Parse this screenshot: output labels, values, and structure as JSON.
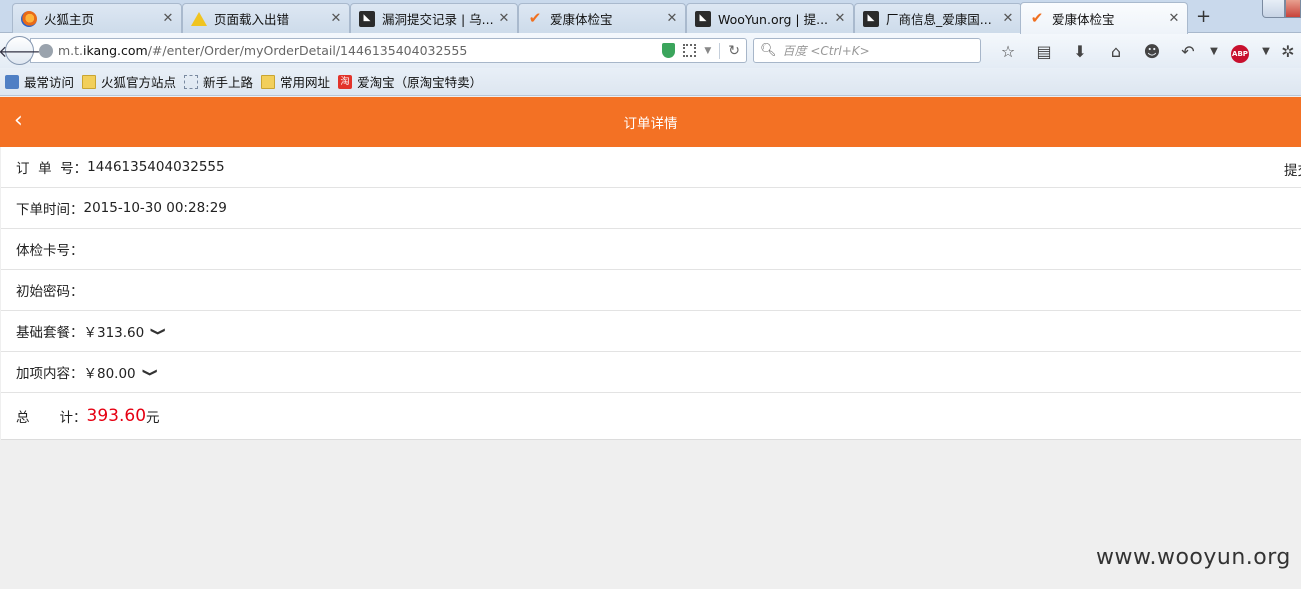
{
  "browser": {
    "tabs": [
      {
        "label": "火狐主页",
        "icon": "firefox-icon"
      },
      {
        "label": "页面载入出错",
        "icon": "warning-icon"
      },
      {
        "label": "漏洞提交记录 | 乌...",
        "icon": "wooyun-icon"
      },
      {
        "label": "爱康体检宝",
        "icon": "ikang-check-icon"
      },
      {
        "label": "WooYun.org | 提...",
        "icon": "wooyun-icon"
      },
      {
        "label": "厂商信息_爱康国...",
        "icon": "wooyun-icon"
      },
      {
        "label": "爱康体检宝",
        "icon": "ikang-check-icon",
        "active": true
      }
    ],
    "new_tab": "+",
    "url": {
      "prefix": "m.t.",
      "domain": "ikang.com",
      "path": "/#/enter/Order/myOrderDetail/1446135404032555"
    },
    "search_placeholder": "百度 <Ctrl+K>",
    "bookmarks": [
      {
        "label": "最常访问",
        "icon": "star-icon"
      },
      {
        "label": "火狐官方站点",
        "icon": "folder-icon"
      },
      {
        "label": "新手上路",
        "icon": "dashed-box-icon"
      },
      {
        "label": "常用网址",
        "icon": "folder-icon"
      },
      {
        "label": "爱淘宝（原淘宝特卖）",
        "icon": "taobao-icon"
      }
    ],
    "taobao_icon_glyph": "淘",
    "abp_glyph": "ABP"
  },
  "page": {
    "header": {
      "title": "订单详情",
      "back": "<"
    },
    "rows": [
      {
        "label": "订  单  号：",
        "value": "1446135404032555"
      },
      {
        "label": "下单时间：",
        "value": "2015-10-30 00:28:29"
      },
      {
        "label": "体检卡号：",
        "value": ""
      },
      {
        "label": "初始密码：",
        "value": ""
      },
      {
        "label": "基础套餐：",
        "value": "￥313.60"
      },
      {
        "label": "加项内容：",
        "value": "￥80.00"
      }
    ],
    "row_right_fragment": "提交",
    "total": {
      "label": "总       计：",
      "amount": "393.60",
      "unit": "元"
    },
    "amount_color": "#e60012",
    "accent_color": "#f37124"
  },
  "watermark": "www.wooyun.org"
}
